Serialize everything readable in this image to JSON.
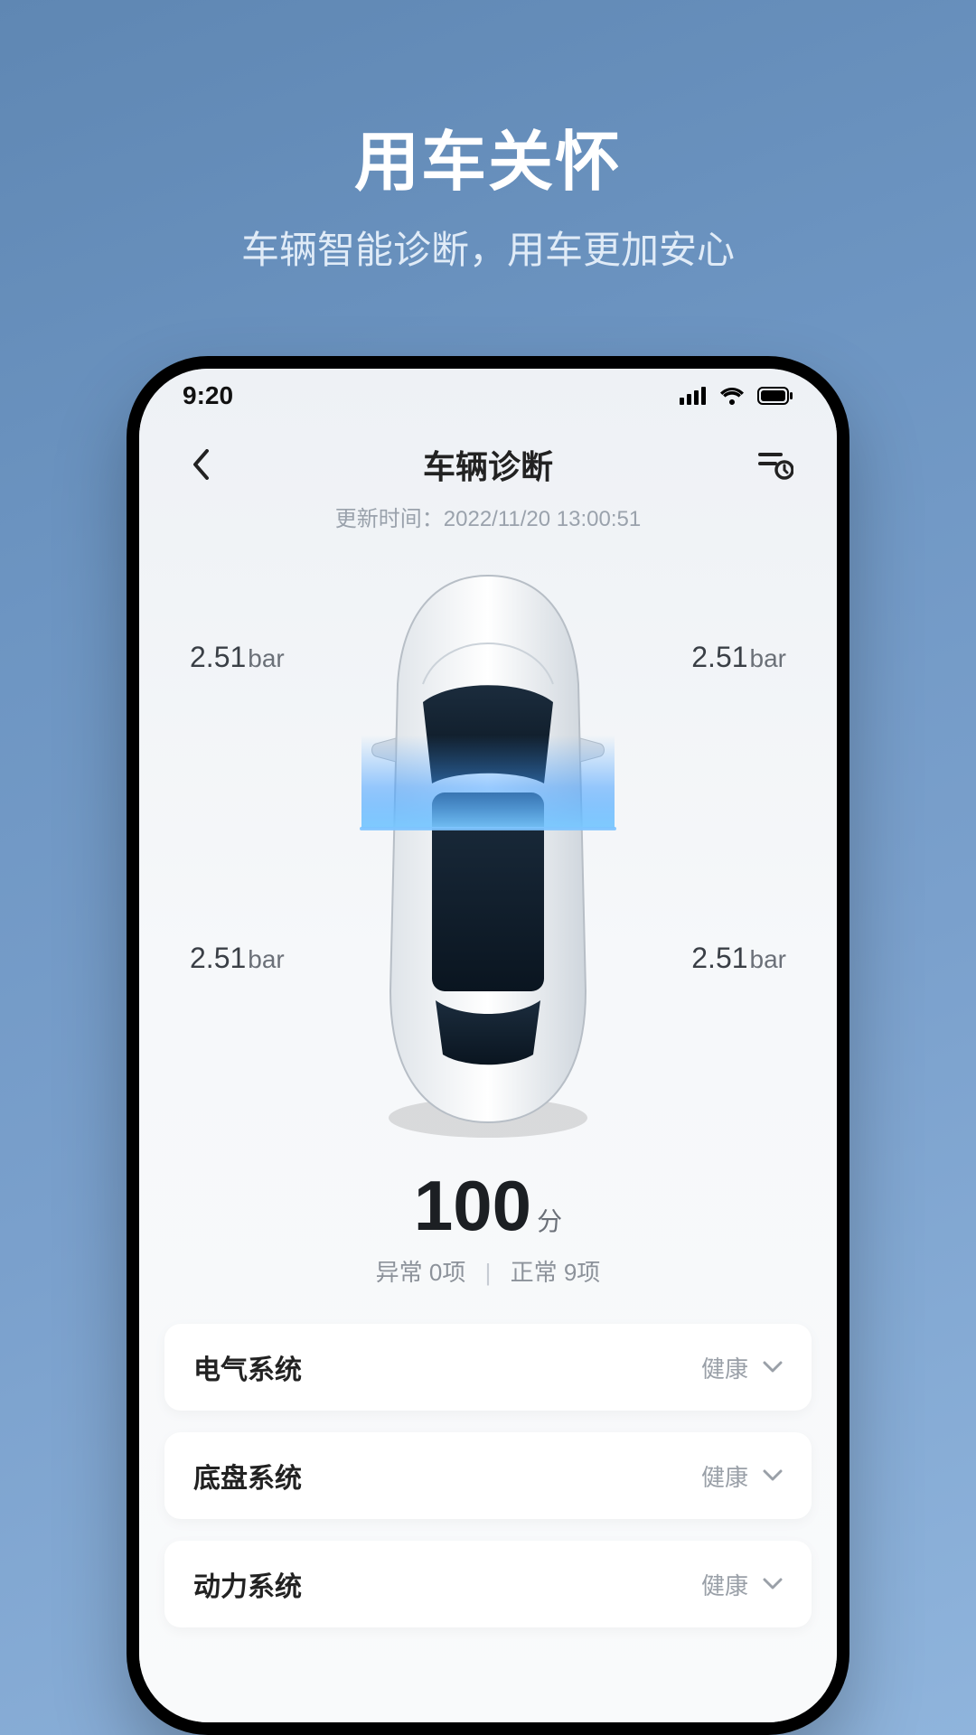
{
  "hero": {
    "title": "用车关怀",
    "subtitle": "车辆智能诊断，用车更加安心"
  },
  "status": {
    "time": "9:20"
  },
  "nav": {
    "title": "车辆诊断"
  },
  "update": {
    "label": "更新时间：",
    "value": "2022/11/20 13:00:51"
  },
  "tires": {
    "fl": {
      "value": "2.51",
      "unit": "bar"
    },
    "fr": {
      "value": "2.51",
      "unit": "bar"
    },
    "rl": {
      "value": "2.51",
      "unit": "bar"
    },
    "rr": {
      "value": "2.51",
      "unit": "bar"
    }
  },
  "score": {
    "value": "100",
    "unit": "分",
    "abnormal_label": "异常 ",
    "abnormal_count": "0项",
    "normal_label": "正常 ",
    "normal_count": "9项"
  },
  "systems": [
    {
      "name": "电气系统",
      "status": "健康"
    },
    {
      "name": "底盘系统",
      "status": "健康"
    },
    {
      "name": "动力系统",
      "status": "健康"
    }
  ]
}
